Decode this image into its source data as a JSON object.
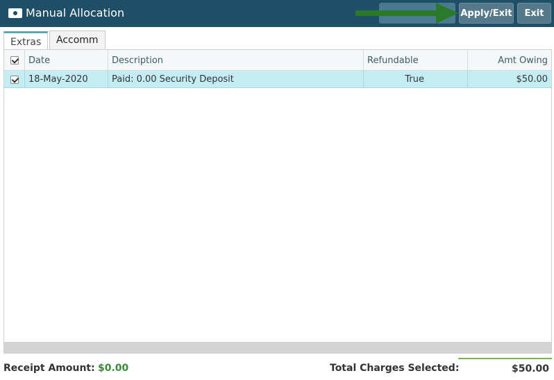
{
  "window": {
    "title": "Manual Allocation",
    "icon": "cash-icon"
  },
  "toolbar": {
    "apply_exit_label": "Apply/Exit",
    "exit_label": "Exit"
  },
  "tabs": [
    {
      "label": "Extras",
      "active": true
    },
    {
      "label": "Accomm",
      "active": false
    }
  ],
  "grid": {
    "columns": [
      "",
      "Date",
      "Description",
      "Refundable",
      "Amt Owing"
    ],
    "header_checked": true,
    "rows": [
      {
        "checked": true,
        "date": "18-May-2020",
        "description": "Paid: 0.00 Security Deposit",
        "refundable": "True",
        "amt_owing": "$50.00"
      }
    ]
  },
  "footer": {
    "receipt_label": "Receipt Amount:",
    "receipt_value": "$0.00",
    "total_label": "Total Charges Selected:",
    "total_value": "$50.00"
  },
  "colors": {
    "titlebar": "#1f4f66",
    "row_selected": "#c4ecf3",
    "receipt_value": "#3a8a3a",
    "arrow": "#2a7a2a"
  }
}
